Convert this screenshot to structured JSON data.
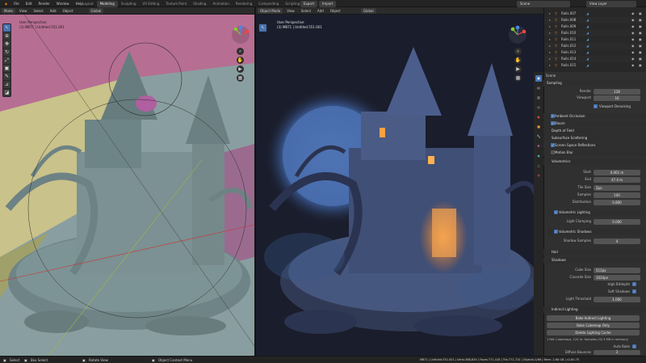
{
  "menu": [
    "File",
    "Edit",
    "Render",
    "Window",
    "Help"
  ],
  "workspaces": [
    "Layout",
    "Modeling",
    "Sculpting",
    "UV Editing",
    "Texture Paint",
    "Shading",
    "Animation",
    "Rendering",
    "Compositing",
    "Scripting"
  ],
  "active_workspace": "Modeling",
  "topbar_right": {
    "export": "Export",
    "import": "Import",
    "scene": "Scene",
    "view_layer": "View Layer"
  },
  "left_viewport": {
    "header": [
      "Mode",
      "View",
      "Select",
      "Add",
      "Object"
    ],
    "orientation": "Global",
    "overlay_title": "User Perspective",
    "overlay_sub": "(3) MB71 | Untitled.551.001"
  },
  "right_viewport": {
    "header": [
      "Object Mode",
      "View",
      "Select",
      "Add",
      "Object"
    ],
    "orientation": "Global",
    "overlay_title": "User Perspective",
    "overlay_sub": "(3) MB71 | Untitled.551.001"
  },
  "outliner": {
    "items": [
      "Rails.007",
      "Rails.008",
      "Rails.009",
      "Rails.010",
      "Rails.011",
      "Rails.012",
      "Rails.013",
      "Rails.014",
      "Rails.015"
    ],
    "header_label": "Scene"
  },
  "props": {
    "sampling": "Sampling",
    "render_lbl": "Render",
    "render_val": "128",
    "viewport_lbl": "Viewport",
    "viewport_val": "16",
    "viewport_denoising": "Viewport Denoising",
    "ambient_occlusion": "Ambient Occlusion",
    "bloom": "Bloom",
    "depth_of_field": "Depth of Field",
    "subsurface": "Subsurface Scattering",
    "ssr": "Screen Space Reflections",
    "motion_blur": "Motion Blur",
    "volumetrics": "Volumetrics",
    "start_lbl": "Start",
    "start_val": "0.001 m",
    "end_lbl": "End",
    "end_val": "47.4 m",
    "tile_lbl": "Tile Size",
    "tile_val": "2px",
    "samples_lbl": "Samples",
    "samples_val": "100",
    "distribution_lbl": "Distribution",
    "distribution_val": "0.800",
    "vol_lighting": "Volumetric Lighting",
    "light_clamp_lbl": "Light Clamping",
    "light_clamp_val": "0.000",
    "vol_shadows": "Volumetric Shadows",
    "shadow_samples_lbl": "Shadow Samples",
    "shadow_samples_val": "4",
    "hair": "Hair",
    "shadows": "Shadows",
    "cube_lbl": "Cube Size",
    "cube_val": "512px",
    "cascade_lbl": "Cascade Size",
    "cascade_val": "1024px",
    "high_bit": "High Bitdepth",
    "soft_shadows": "Soft Shadows",
    "light_thresh_lbl": "Light Threshold",
    "light_thresh_val": "1.000",
    "indirect": "Indirect Lighting",
    "bake_indirect": "Bake Indirect Lighting",
    "bake_cubemap": "Bake Cubemap Only",
    "delete_cache": "Delete Lighting Cache",
    "cache_info": "1 Ref. Cubemaps, 125 Irr. Samples (32.3 MB in memory)",
    "auto_bake": "Auto Bake",
    "diffuse_lbl": "Diffuse Bounces",
    "diffuse_val": "3"
  },
  "status": {
    "select": "Select",
    "box_select": "Box Select",
    "rotate": "Rotate View",
    "context": "Object Context Menu",
    "stats": "MB71 | Untitled.551.001 | Verts:388,630 | Faces:771,416 | Tris:771,710 | Objects:1/66 | Mem: 2.68 GB | v2.80.75"
  },
  "colors": {
    "accent": "#4772b3",
    "bg_left": "#8a9ea1",
    "bg_right": "#1b1f2e",
    "moon": "#5c7fbf"
  }
}
